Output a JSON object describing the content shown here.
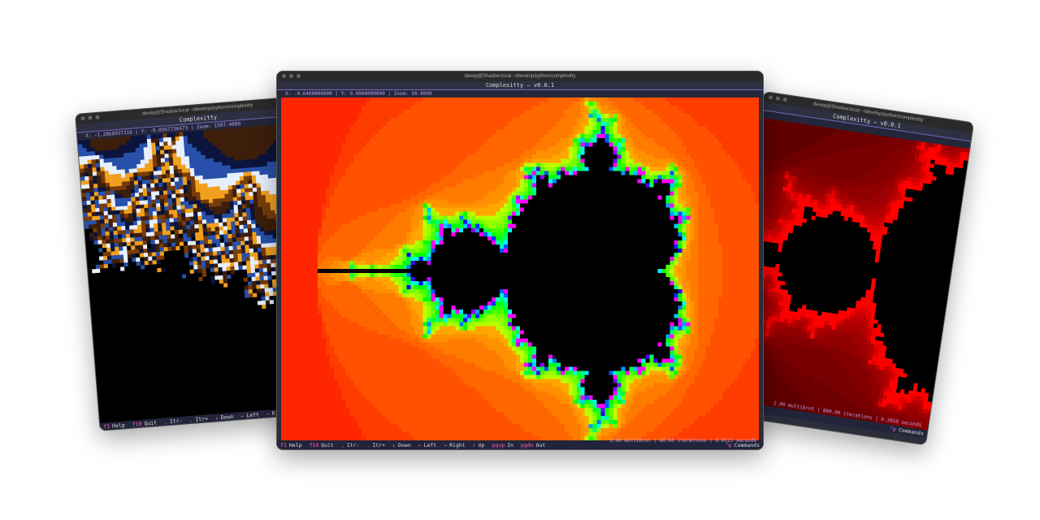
{
  "windows": {
    "left": {
      "titlebar": "davep@Shadow.local ~/develop/python/complexitty",
      "app_title": "Complexitty",
      "header": "X: -1.2860937316 | Y: -0.0567736473 | Zoom: 1597.4080",
      "status": "",
      "palette": "blue-orange"
    },
    "center": {
      "titlebar": "davep@Shadow.local ~/develop/python/complexitty",
      "app_title": "Complexitty — v0.0.1",
      "header": "X: -0.6400000000 | Y: 0.0000000000 | Zoom: 50.0000",
      "status": "2.00 multibrot | 80.00 iterations | 0.0523 seconds",
      "palette": "rainbow"
    },
    "right": {
      "titlebar": "davep@Shadow.local ~/develop/python/complexitty",
      "app_title": "Complexitty — v0.0.1",
      "header": "",
      "status": "2.00 multibrot | 800.00 iterations | 0.3050 seconds",
      "palette": "red"
    }
  },
  "footer": {
    "keys": [
      {
        "k": "f1",
        "l": "Help"
      },
      {
        "k": "f10",
        "l": "Quit"
      },
      {
        "k": ",",
        "l": "Itr-"
      },
      {
        "k": ".",
        "l": "Itr+"
      },
      {
        "k": "↓",
        "l": "Down"
      },
      {
        "k": "←",
        "l": "Left"
      },
      {
        "k": "→",
        "l": "Right"
      },
      {
        "k": "↑",
        "l": "Up"
      },
      {
        "k": "pgup",
        "l": "In"
      },
      {
        "k": "pgdn",
        "l": "Out"
      }
    ],
    "commands_key": "^p",
    "commands_label": "Commands"
  }
}
